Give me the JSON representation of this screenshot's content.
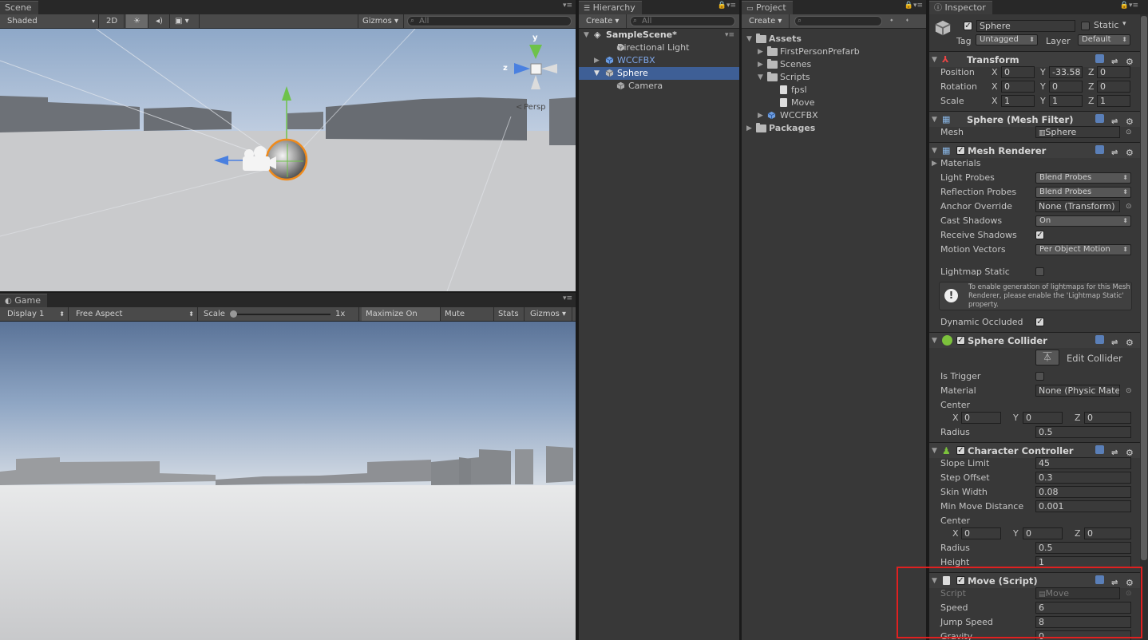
{
  "scene": {
    "tab": "Scene",
    "shading": "Shaded",
    "mode_2d": "2D",
    "gizmos": "Gizmos",
    "search_placeholder": "All",
    "persp_label": "Persp",
    "gizmo_axes": {
      "y": "y",
      "z": "z"
    }
  },
  "game": {
    "tab": "Game",
    "display": "Display 1",
    "aspect": "Free Aspect",
    "scale_label": "Scale",
    "scale_value": "1x",
    "maximize": "Maximize On Play",
    "mute": "Mute Audio",
    "stats": "Stats",
    "gizmos": "Gizmos"
  },
  "hierarchy": {
    "tab": "Hierarchy",
    "create": "Create",
    "search_placeholder": "All",
    "scene_name": "SampleScene*",
    "items": [
      {
        "label": "Directional Light"
      },
      {
        "label": "WCCFBX"
      },
      {
        "label": "Sphere"
      },
      {
        "label": "Camera"
      }
    ]
  },
  "project": {
    "tab": "Project",
    "create": "Create",
    "items": [
      {
        "label": "Assets"
      },
      {
        "label": "FirstPersonPrefarb"
      },
      {
        "label": "Scenes"
      },
      {
        "label": "Scripts"
      },
      {
        "label": "fpsl"
      },
      {
        "label": "Move"
      },
      {
        "label": "WCCFBX"
      },
      {
        "label": "Packages"
      }
    ]
  },
  "inspector": {
    "tab": "Inspector",
    "object_name": "Sphere",
    "static_label": "Static",
    "tag_label": "Tag",
    "tag_value": "Untagged",
    "layer_label": "Layer",
    "layer_value": "Default",
    "transform": {
      "title": "Transform",
      "position_label": "Position",
      "rotation_label": "Rotation",
      "scale_label": "Scale",
      "position": {
        "x": "0",
        "y": "-33.58",
        "z": "0"
      },
      "rotation": {
        "x": "0",
        "y": "0",
        "z": "0"
      },
      "scale": {
        "x": "1",
        "y": "1",
        "z": "1"
      }
    },
    "mesh_filter": {
      "title": "Sphere (Mesh Filter)",
      "mesh_label": "Mesh",
      "mesh_value": "Sphere"
    },
    "mesh_renderer": {
      "title": "Mesh Renderer",
      "materials": "Materials",
      "light_probes_label": "Light Probes",
      "light_probes": "Blend Probes",
      "reflection_probes_label": "Reflection Probes",
      "reflection_probes": "Blend Probes",
      "anchor_override_label": "Anchor Override",
      "anchor_override": "None (Transform)",
      "cast_shadows_label": "Cast Shadows",
      "cast_shadows": "On",
      "receive_shadows_label": "Receive Shadows",
      "motion_vectors_label": "Motion Vectors",
      "motion_vectors": "Per Object Motion",
      "lightmap_static_label": "Lightmap Static",
      "info_text": "To enable generation of lightmaps for this Mesh Renderer, please enable the 'Lightmap Static' property.",
      "dynamic_occluded_label": "Dynamic Occluded"
    },
    "sphere_collider": {
      "title": "Sphere Collider",
      "edit_collider": "Edit Collider",
      "is_trigger_label": "Is Trigger",
      "material_label": "Material",
      "material_value": "None (Physic Mate",
      "center_label": "Center",
      "center": {
        "x": "0",
        "y": "0",
        "z": "0"
      },
      "radius_label": "Radius",
      "radius": "0.5"
    },
    "character_controller": {
      "title": "Character Controller",
      "slope_limit_label": "Slope Limit",
      "slope_limit": "45",
      "step_offset_label": "Step Offset",
      "step_offset": "0.3",
      "skin_width_label": "Skin Width",
      "skin_width": "0.08",
      "min_move_label": "Min Move Distance",
      "min_move": "0.001",
      "center_label": "Center",
      "center": {
        "x": "0",
        "y": "0",
        "z": "0"
      },
      "radius_label": "Radius",
      "radius": "0.5",
      "height_label": "Height",
      "height": "1"
    },
    "move_script": {
      "title": "Move (Script)",
      "script_label": "Script",
      "script_value": "Move",
      "speed_label": "Speed",
      "speed": "6",
      "jump_label": "Jump Speed",
      "jump": "8",
      "gravity_label": "Gravity",
      "gravity": "0"
    }
  },
  "axis_letters": {
    "x": "X",
    "y": "Y",
    "z": "Z"
  },
  "colors": {
    "selection": "#3e5f96",
    "highlight_box": "#e02020",
    "panel_bg": "#383838"
  }
}
